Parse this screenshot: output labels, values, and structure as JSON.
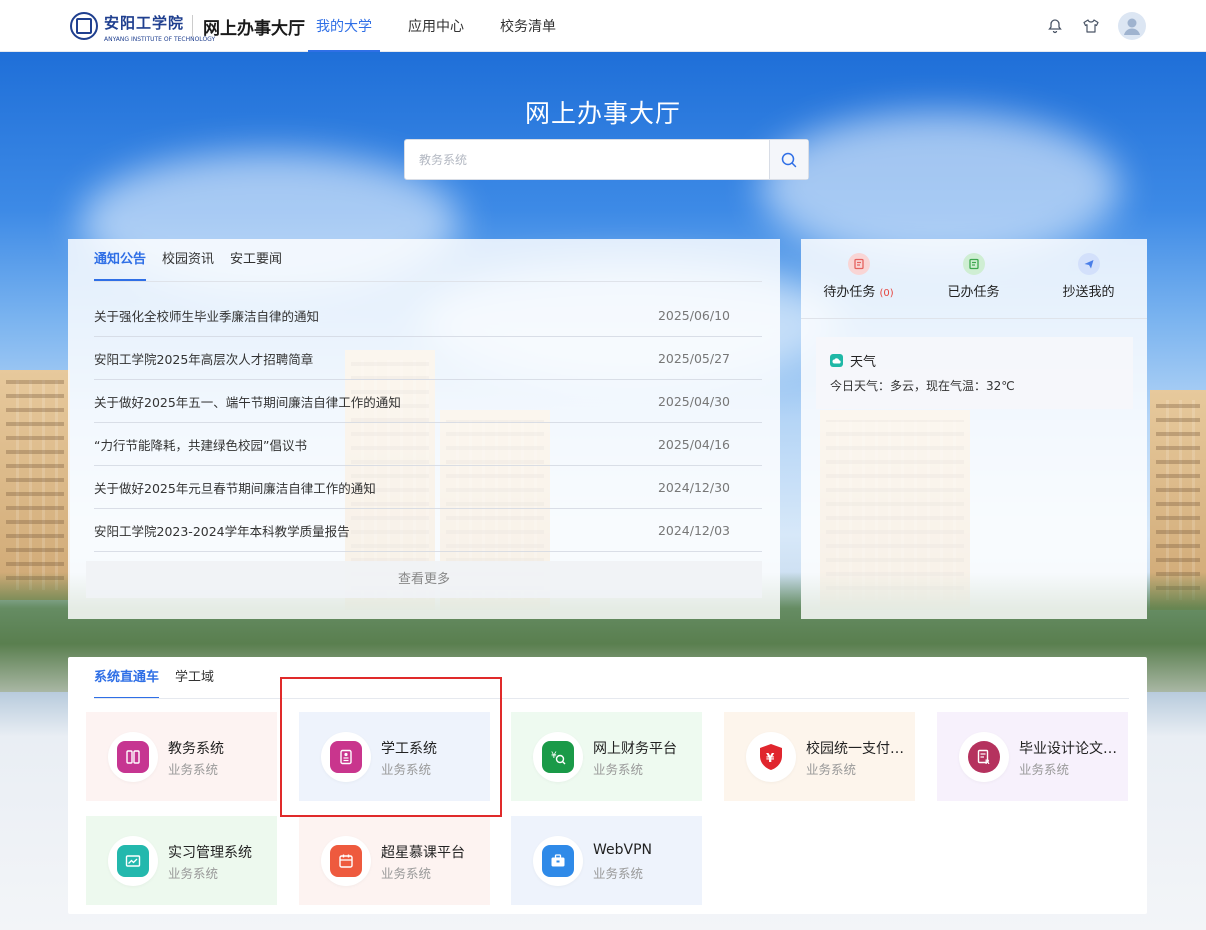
{
  "header": {
    "logo_script": "安阳工学院",
    "logo_english": "ANYANG INSTITUTE OF TECHNOLOGY",
    "title": "网上办事大厅",
    "nav": [
      {
        "label": "我的大学",
        "active": true
      },
      {
        "label": "应用中心",
        "active": false
      },
      {
        "label": "校务清单",
        "active": false
      }
    ],
    "icons": [
      "bell-icon",
      "shirt-icon",
      "avatar"
    ]
  },
  "hero": {
    "title": "网上办事大厅",
    "search_placeholder": "教务系统"
  },
  "notices": {
    "tabs": [
      {
        "label": "通知公告",
        "active": true
      },
      {
        "label": "校园资讯",
        "active": false
      },
      {
        "label": "安工要闻",
        "active": false
      }
    ],
    "items": [
      {
        "title": "关于强化全校师生毕业季廉洁自律的通知",
        "date": "2025/06/10"
      },
      {
        "title": "安阳工学院2025年高层次人才招聘简章",
        "date": "2025/05/27"
      },
      {
        "title": "关于做好2025年五一、端午节期间廉洁自律工作的通知",
        "date": "2025/04/30"
      },
      {
        "title": "“力行节能降耗，共建绿色校园”倡议书",
        "date": "2025/04/16"
      },
      {
        "title": "关于做好2025年元旦春节期间廉洁自律工作的通知",
        "date": "2024/12/30"
      },
      {
        "title": "安阳工学院2023-2024学年本科教学质量报告",
        "date": "2024/12/03"
      }
    ],
    "more_label": "查看更多"
  },
  "tasks": {
    "items": [
      {
        "label": "待办任务",
        "count": "(0)",
        "color": "#f08a8a"
      },
      {
        "label": "已办任务",
        "count": "",
        "color": "#5cc26a"
      },
      {
        "label": "抄送我的",
        "count": "",
        "color": "#4a7ee8"
      }
    ],
    "weather_title": "天气",
    "weather_text": "今日天气：多云，现在气温：32℃"
  },
  "systems": {
    "tabs": [
      {
        "label": "系统直通车",
        "active": true
      },
      {
        "label": "学工域",
        "active": false
      }
    ],
    "cards": [
      {
        "name": "教务系统",
        "sub": "业务系统",
        "bg": "#fdf3f2",
        "icon_color": "#c63591",
        "icon": "phone-icon"
      },
      {
        "name": "学工系统",
        "sub": "业务系统",
        "bg": "#eef3fc",
        "icon_color": "#c9358d",
        "icon": "badge-icon"
      },
      {
        "name": "网上财务平台",
        "sub": "业务系统",
        "bg": "#eefaf0",
        "icon_color": "#1a9a48",
        "icon": "finance-search-icon"
      },
      {
        "name": "校园统一支付平台",
        "sub": "业务系统",
        "bg": "#fdf5ec",
        "icon_color": "#e0262e",
        "icon": "yen-shield-icon"
      },
      {
        "name": "毕业设计论文管理系统",
        "sub": "业务系统",
        "bg": "#f7f1fc",
        "icon_color": "#b5325e",
        "icon": "document-icon"
      },
      {
        "name": "实习管理系统",
        "sub": "业务系统",
        "bg": "#edf9ee",
        "icon_color": "#23b8ad",
        "icon": "chart-icon"
      },
      {
        "name": "超星慕课平台",
        "sub": "业务系统",
        "bg": "#fdf3f1",
        "icon_color": "#ee5a3e",
        "icon": "calendar-icon"
      },
      {
        "name": "WebVPN",
        "sub": "业务系统",
        "bg": "#eef3fc",
        "icon_color": "#2f8ae8",
        "icon": "briefcase-icon"
      }
    ]
  }
}
